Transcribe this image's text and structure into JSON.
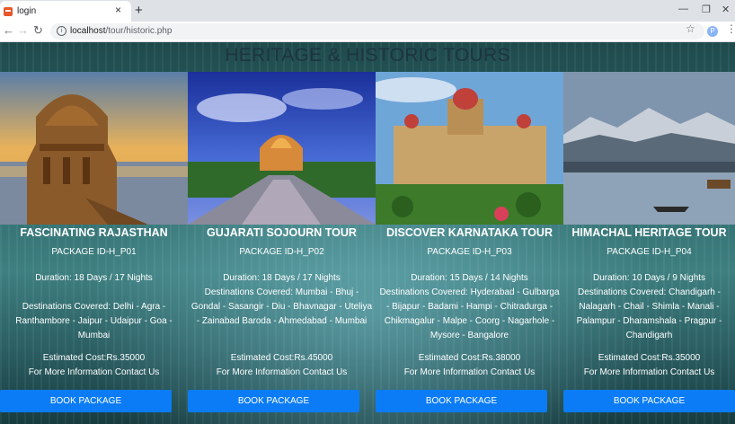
{
  "browser": {
    "tab_title": "login",
    "tab_close": "×",
    "new_tab": "+",
    "url_host": "localhost",
    "url_path": "/tour/historic.php",
    "minimize": "—",
    "restore": "❐",
    "close": "✕",
    "avatar_letter": "P"
  },
  "page": {
    "title": "HERITAGE & HISTORIC TOURS"
  },
  "cards": [
    {
      "name": "FASCINATING RAJASTHAN",
      "package_id": "PACKAGE ID-H_P01",
      "duration": "Duration: 18 Days / 17 Nights",
      "destinations": "Destinations Covered: Delhi - Agra - Ranthambore - Jaipur - Udaipur - Goa - Mumbai",
      "cost": "Estimated Cost:Rs.35000",
      "contact": "For More Information Contact Us",
      "button": "BOOK PACKAGE"
    },
    {
      "name": "GUJARATI SOJOURN TOUR",
      "package_id": "PACKAGE ID-H_P02",
      "duration": "Duration: 18 Days / 17 Nights",
      "destinations": "Destinations Covered: Mumbai - Bhuj - Gondal - Sasangir - Diu - Bhavnagar - Uteliya - Zainabad Baroda - Ahmedabad - Mumbai",
      "cost": "Estimated Cost:Rs.45000",
      "contact": "For More Information Contact Us",
      "button": "BOOK PACKAGE"
    },
    {
      "name": "DISCOVER KARNATAKA TOUR",
      "package_id": "PACKAGE ID-H_P03",
      "duration": "Duration: 15 Days / 14 Nights",
      "destinations": "Destinations Covered: Hyderabad - Gulbarga - Bijapur - Badami - Hampi - Chitradurga - Chikmagalur - Malpe - Coorg - Nagarhole - Mysore - Bangalore",
      "cost": "Estimated Cost:Rs.38000",
      "contact": "For More Information Contact Us",
      "button": "BOOK PACKAGE"
    },
    {
      "name": "HIMACHAL HERITAGE TOUR",
      "package_id": "PACKAGE ID-H_P04",
      "duration": "Duration: 10 Days / 9 Nights",
      "destinations": "Destinations Covered: Chandigarh - Nalagarh - Chail - Shimla - Manali - Palampur - Dharamshala - Pragpur - Chandigarh",
      "cost": "Estimated Cost:Rs.35000",
      "contact": "For More Information Contact Us",
      "button": "BOOK PACKAGE"
    }
  ]
}
